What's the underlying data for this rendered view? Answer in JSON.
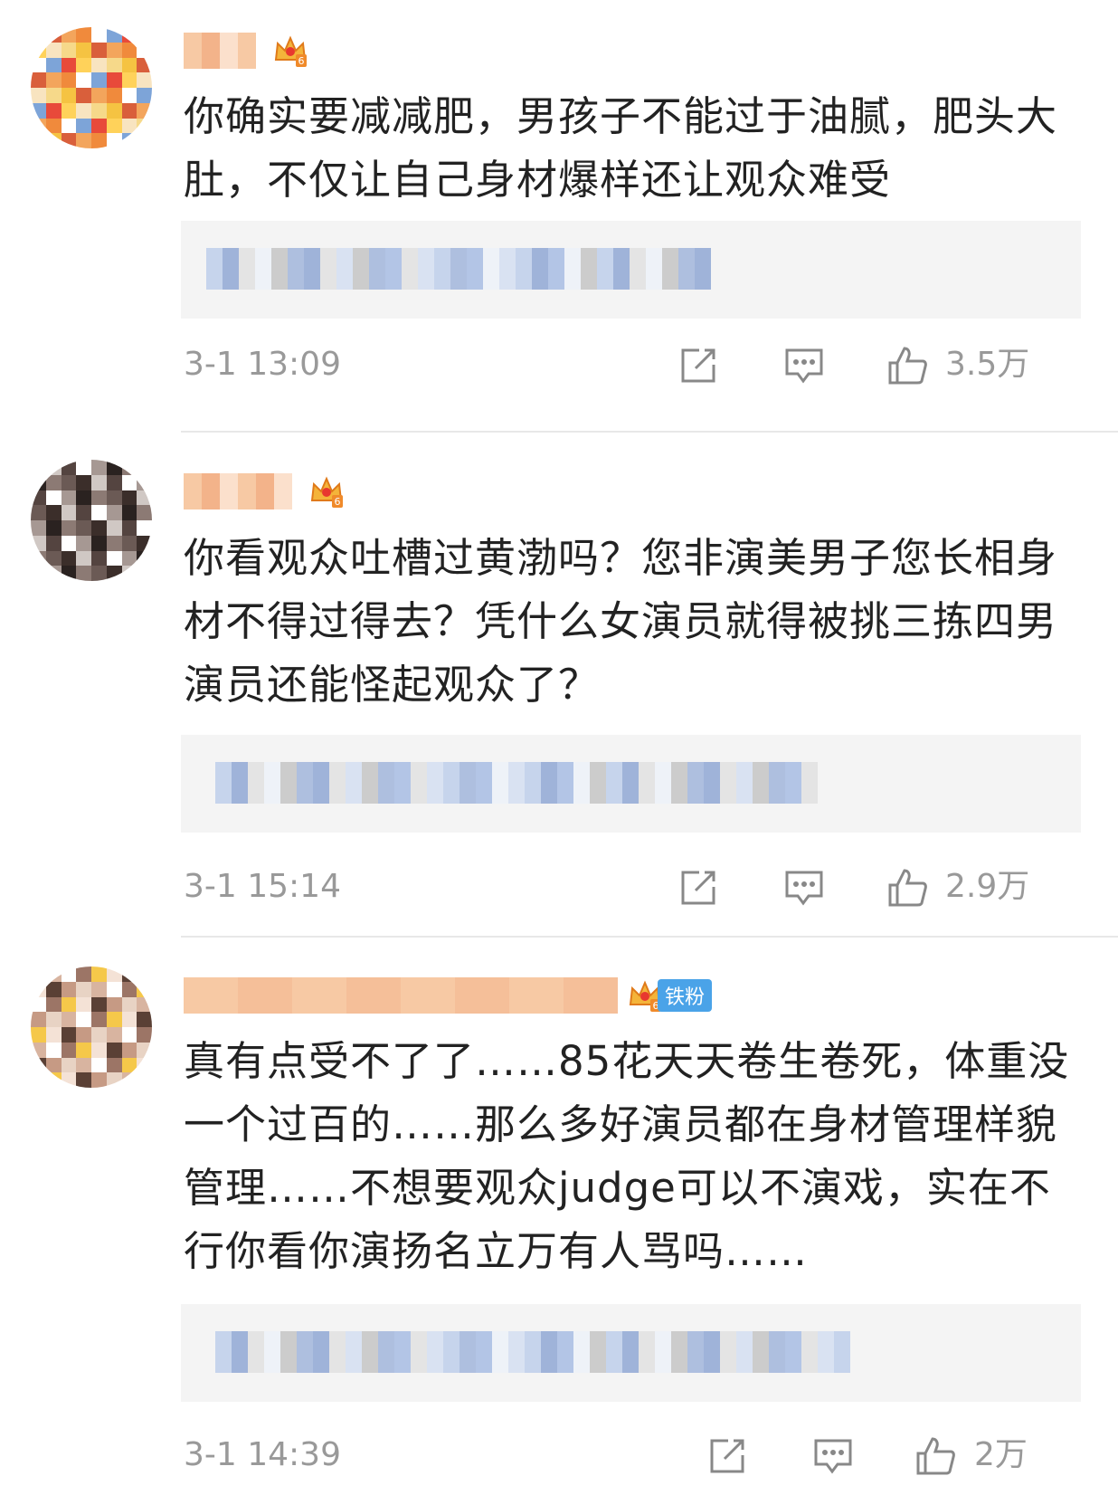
{
  "comments": [
    {
      "text": "你确实要减减肥，男孩子不能过于油腻，肥头大肚，不仅让自己身材爆样还让观众难受",
      "time": "3-1 13:09",
      "likes": "3.5万",
      "level_icon": "crown-level-6-icon"
    },
    {
      "text": "你看观众吐槽过黄渤吗？您非演美男子您长相身材不得过得去？凭什么女演员就得被挑三拣四男演员还能怪起观众了？",
      "time": "3-1 15:14",
      "likes": "2.9万",
      "level_icon": "crown-level-6-icon"
    },
    {
      "text": "真有点受不了了……85花天天卷生卷死，体重没一个过百的……那么多好演员都在身材管理样貌管理……不想要观众judge可以不演戏，实在不行你看你演扬名立万有人骂吗……",
      "time": "3-1 14:39",
      "likes": "2万",
      "level_icon": "crown-level-6-icon",
      "fan_badge": "铁粉"
    }
  ],
  "icons": {
    "share": "share-icon",
    "comment": "comment-icon",
    "like": "thumbs-up-icon"
  },
  "colors": {
    "text": "#222222",
    "meta": "#999999",
    "quote_bg": "#f4f4f4",
    "badge": "#4aa3e8"
  }
}
